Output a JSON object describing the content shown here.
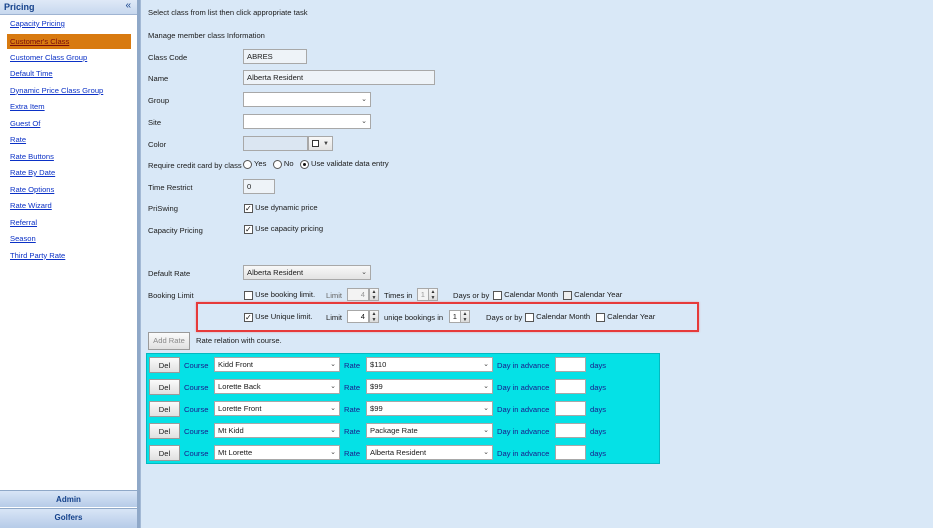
{
  "sidebar": {
    "title": "Pricing",
    "collapse_icon": "«",
    "items": [
      {
        "label": "Capacity Pricing",
        "active": false
      },
      {
        "label": "Customer's Class",
        "active": true
      },
      {
        "label": "Customer Class Group",
        "active": false
      },
      {
        "label": "Default Time",
        "active": false
      },
      {
        "label": "Dynamic Price Class Group",
        "active": false
      },
      {
        "label": "Extra Item",
        "active": false
      },
      {
        "label": "Guest Of",
        "active": false
      },
      {
        "label": "Rate",
        "active": false
      },
      {
        "label": "Rate Buttons",
        "active": false
      },
      {
        "label": "Rate By Date",
        "active": false
      },
      {
        "label": "Rate Options",
        "active": false
      },
      {
        "label": "Rate Wizard",
        "active": false
      },
      {
        "label": "Referral",
        "active": false
      },
      {
        "label": "Season",
        "active": false
      },
      {
        "label": "Third Party Rate",
        "active": false
      }
    ],
    "bottom_sections": [
      "Admin",
      "Golfers"
    ]
  },
  "main": {
    "instruction": "Select class from list then click appropriate task",
    "subtitle": "Manage member class Information",
    "fields": {
      "class_code": {
        "label": "Class Code",
        "value": "ABRES"
      },
      "name": {
        "label": "Name",
        "value": "Alberta Resident"
      },
      "group": {
        "label": "Group",
        "value": ""
      },
      "site": {
        "label": "Site",
        "value": ""
      },
      "color": {
        "label": "Color",
        "value": ""
      },
      "require_cc": {
        "label": "Require credit card by class",
        "options": [
          "Yes",
          "No",
          "Use validate data entry"
        ],
        "selected": "Use validate data entry"
      },
      "time_restrict": {
        "label": "Time Restrict",
        "value": "0"
      },
      "priswing": {
        "label": "PriSwing",
        "checkbox_label": "Use dynamic price",
        "checked": true
      },
      "capacity_pricing": {
        "label": "Capacity Pricing",
        "checkbox_label": "Use capacity pricing",
        "checked": true
      },
      "default_rate": {
        "label": "Default Rate",
        "value": "Alberta Resident"
      }
    },
    "booking_limit": {
      "label": "Booking Limit",
      "row1": {
        "checkbox_label": "Use booking limit.",
        "checked": false,
        "limit_label": "Limit",
        "limit_value": "4",
        "times_label": "Times in",
        "days_value": "1",
        "days_label": "Days or by",
        "calendar_month": "Calendar Month",
        "calendar_year": "Calendar Year"
      },
      "row2": {
        "checkbox_label": "Use Unique limit.",
        "checked": true,
        "limit_label": "Limit",
        "limit_value": "4",
        "unique_label": "uniqe bookings in",
        "days_value": "1",
        "days_label": "Days or by",
        "calendar_month": "Calendar Month",
        "calendar_year": "Calendar Year"
      }
    },
    "add_rate": {
      "button": "Add Rate",
      "caption": "Rate relation with course."
    },
    "course_rows": [
      {
        "del": "Del",
        "course_label": "Course",
        "course": "Kidd Front",
        "rate_label": "Rate",
        "rate": "$110",
        "advance_label": "Day in advance",
        "advance": "",
        "days_label": "days"
      },
      {
        "del": "Del",
        "course_label": "Course",
        "course": "Lorette Back",
        "rate_label": "Rate",
        "rate": "$99",
        "advance_label": "Day in advance",
        "advance": "",
        "days_label": "days"
      },
      {
        "del": "Del",
        "course_label": "Course",
        "course": "Lorette Front",
        "rate_label": "Rate",
        "rate": "$99",
        "advance_label": "Day in advance",
        "advance": "",
        "days_label": "days"
      },
      {
        "del": "Del",
        "course_label": "Course",
        "course": "Mt Kidd",
        "rate_label": "Rate",
        "rate": "Package Rate",
        "advance_label": "Day in advance",
        "advance": "",
        "days_label": "days"
      },
      {
        "del": "Del",
        "course_label": "Course",
        "course": "Mt Lorette",
        "rate_label": "Rate",
        "rate": "Alberta Resident",
        "advance_label": "Day in advance",
        "advance": "",
        "days_label": "days"
      }
    ]
  },
  "colors": {
    "accent": "#d87a10",
    "highlight": "#e63a3a",
    "course_panel": "#05e1e6",
    "background": "#d9e8f7"
  }
}
